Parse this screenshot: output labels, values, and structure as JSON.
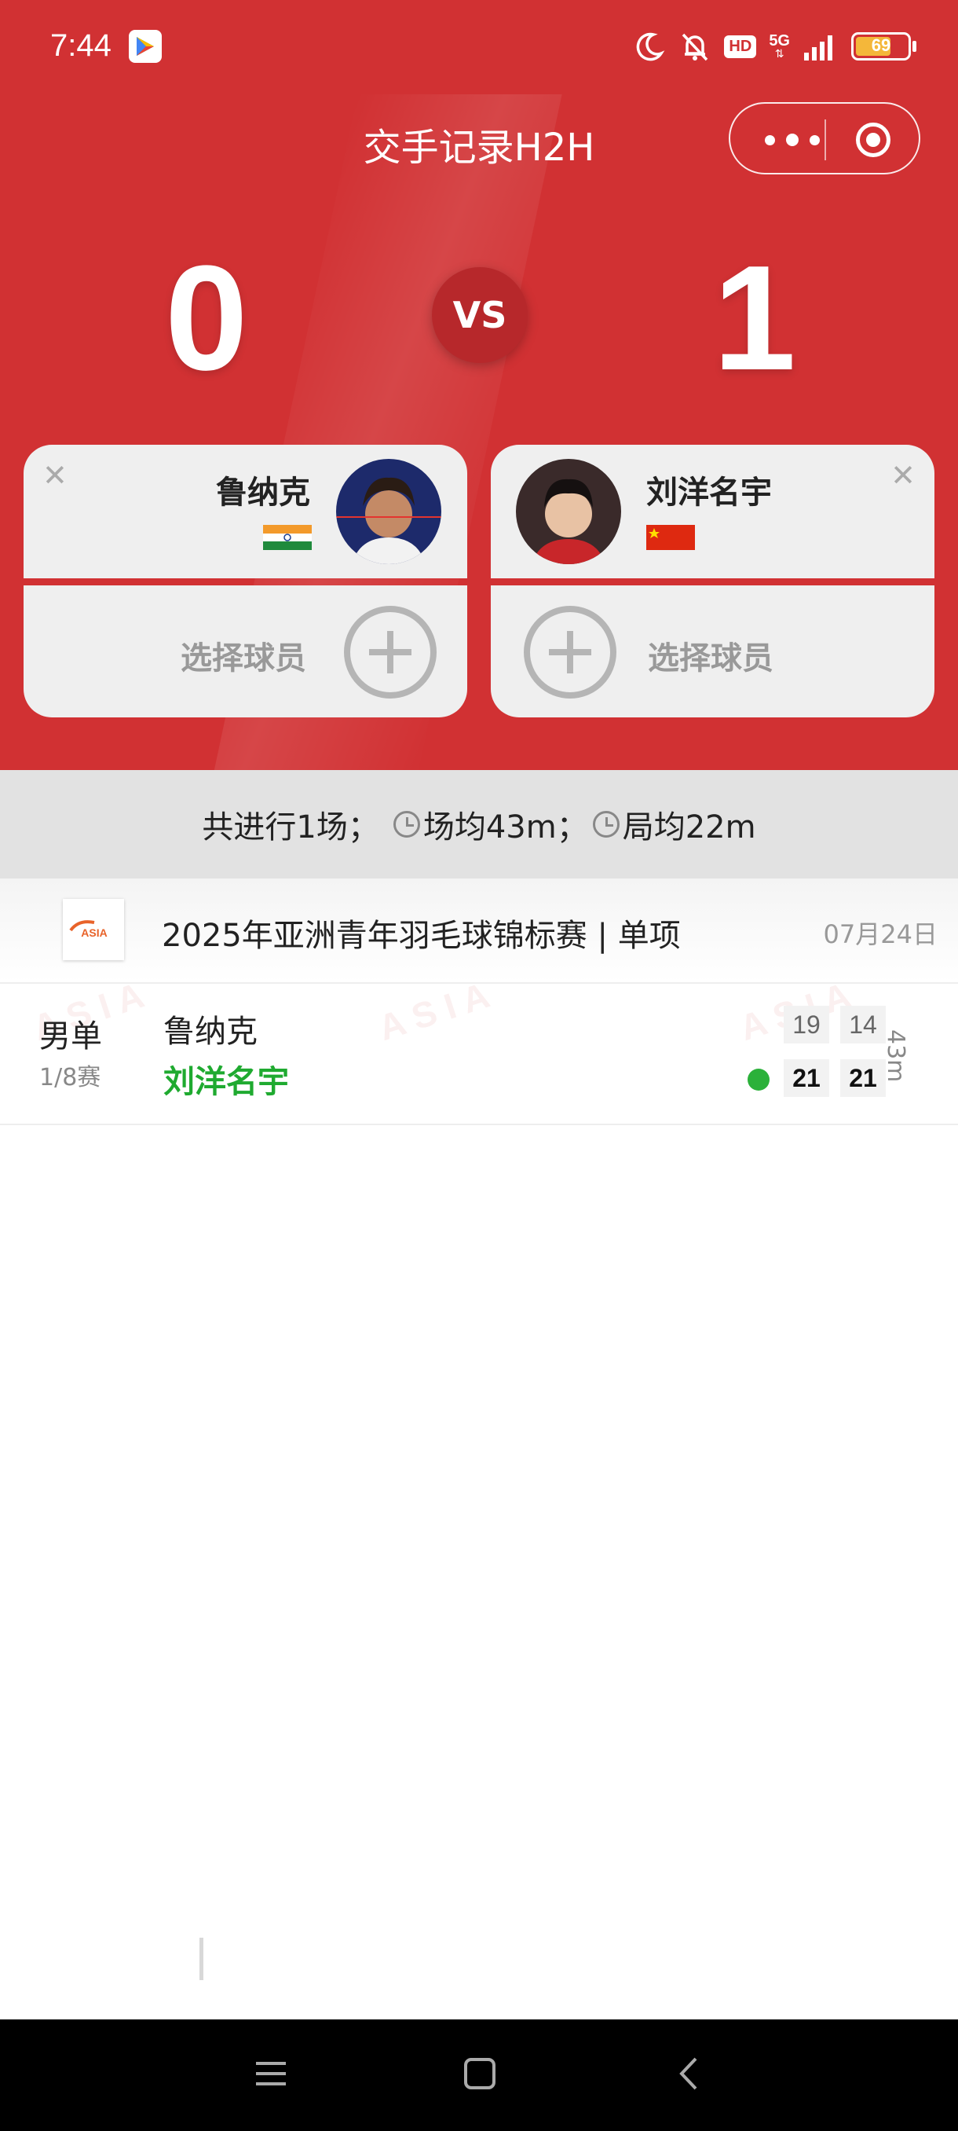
{
  "status_bar": {
    "time": "7:44",
    "hd": "HD",
    "network": "5G",
    "battery": "69",
    "battery_level": 0.69,
    "icons": [
      "play-store-icon",
      "moon-icon",
      "bell-off-icon",
      "signal-icon",
      "battery-icon"
    ]
  },
  "nav": {
    "title": "交手记录H2H"
  },
  "h2h": {
    "score_left": "0",
    "score_right": "1",
    "vs": "VS",
    "player_left": {
      "name": "鲁纳克",
      "flag": "flag-india-icon"
    },
    "player_right": {
      "name": "刘洋名宇",
      "flag": "flag-china-icon"
    },
    "select_label": "选择球员"
  },
  "summary": {
    "total": "共进行1场；",
    "avg_match": "场均43m；",
    "avg_game": "局均22m"
  },
  "tournament": {
    "title": "2025年亚洲青年羽毛球锦标赛 | 单项",
    "date": "07月24日",
    "logo_text": "ASIA"
  },
  "match": {
    "event": "男单",
    "round": "1/8赛",
    "player1": "鲁纳克",
    "player2": "刘洋名宇",
    "p1_scores": [
      "19",
      "14"
    ],
    "p2_scores": [
      "21",
      "21"
    ],
    "duration": "43m"
  },
  "colors": {
    "header_red": "#d13133",
    "winner_green": "#1faa30"
  }
}
